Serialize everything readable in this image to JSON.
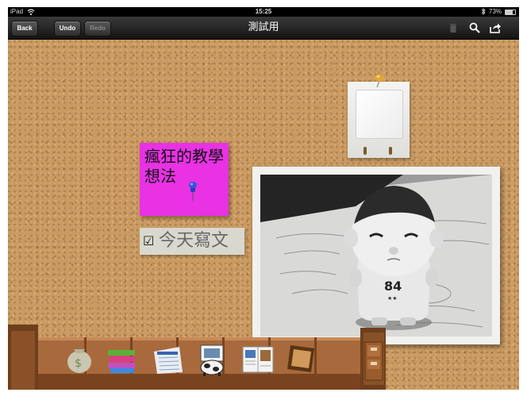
{
  "status": {
    "carrier": "iPad",
    "time": "15:25",
    "battery_text": "73%",
    "battery_level": 0.73
  },
  "toolbar": {
    "back_label": "Back",
    "undo_label": "Undo",
    "redo_label": "Redo",
    "title": "測試用"
  },
  "board": {
    "sticky_note": {
      "text": "瘋狂的教學想法",
      "color": "#e832e3"
    },
    "todo": {
      "checkbox": "☑",
      "text": "今天寫文"
    },
    "photo": {
      "badge_number": "84"
    }
  },
  "dock": {
    "items": [
      "money-bag-icon",
      "books-stack-icon",
      "calendar-icon",
      "cow-card-icon",
      "magazine-icon",
      "cork-frame-icon",
      "drawer-cabinet-icon"
    ]
  },
  "colors": {
    "cork": "#c99a62",
    "toolbar": "#2a2a2a",
    "shelf": "#a86a3c"
  }
}
